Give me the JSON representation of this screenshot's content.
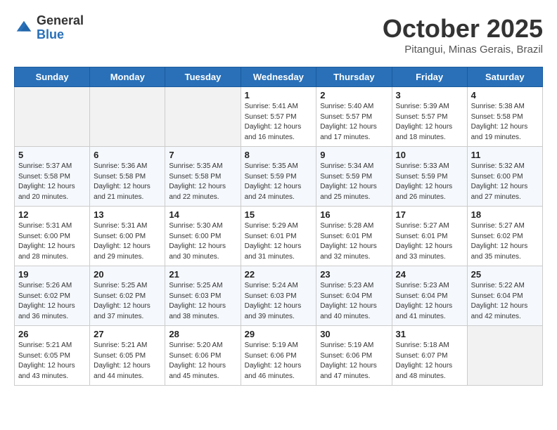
{
  "header": {
    "logo": {
      "general": "General",
      "blue": "Blue"
    },
    "month": "October 2025",
    "location": "Pitangui, Minas Gerais, Brazil"
  },
  "weekdays": [
    "Sunday",
    "Monday",
    "Tuesday",
    "Wednesday",
    "Thursday",
    "Friday",
    "Saturday"
  ],
  "weeks": [
    [
      {
        "day": "",
        "info": ""
      },
      {
        "day": "",
        "info": ""
      },
      {
        "day": "",
        "info": ""
      },
      {
        "day": "1",
        "info": "Sunrise: 5:41 AM\nSunset: 5:57 PM\nDaylight: 12 hours\nand 16 minutes."
      },
      {
        "day": "2",
        "info": "Sunrise: 5:40 AM\nSunset: 5:57 PM\nDaylight: 12 hours\nand 17 minutes."
      },
      {
        "day": "3",
        "info": "Sunrise: 5:39 AM\nSunset: 5:57 PM\nDaylight: 12 hours\nand 18 minutes."
      },
      {
        "day": "4",
        "info": "Sunrise: 5:38 AM\nSunset: 5:58 PM\nDaylight: 12 hours\nand 19 minutes."
      }
    ],
    [
      {
        "day": "5",
        "info": "Sunrise: 5:37 AM\nSunset: 5:58 PM\nDaylight: 12 hours\nand 20 minutes."
      },
      {
        "day": "6",
        "info": "Sunrise: 5:36 AM\nSunset: 5:58 PM\nDaylight: 12 hours\nand 21 minutes."
      },
      {
        "day": "7",
        "info": "Sunrise: 5:35 AM\nSunset: 5:58 PM\nDaylight: 12 hours\nand 22 minutes."
      },
      {
        "day": "8",
        "info": "Sunrise: 5:35 AM\nSunset: 5:59 PM\nDaylight: 12 hours\nand 24 minutes."
      },
      {
        "day": "9",
        "info": "Sunrise: 5:34 AM\nSunset: 5:59 PM\nDaylight: 12 hours\nand 25 minutes."
      },
      {
        "day": "10",
        "info": "Sunrise: 5:33 AM\nSunset: 5:59 PM\nDaylight: 12 hours\nand 26 minutes."
      },
      {
        "day": "11",
        "info": "Sunrise: 5:32 AM\nSunset: 6:00 PM\nDaylight: 12 hours\nand 27 minutes."
      }
    ],
    [
      {
        "day": "12",
        "info": "Sunrise: 5:31 AM\nSunset: 6:00 PM\nDaylight: 12 hours\nand 28 minutes."
      },
      {
        "day": "13",
        "info": "Sunrise: 5:31 AM\nSunset: 6:00 PM\nDaylight: 12 hours\nand 29 minutes."
      },
      {
        "day": "14",
        "info": "Sunrise: 5:30 AM\nSunset: 6:00 PM\nDaylight: 12 hours\nand 30 minutes."
      },
      {
        "day": "15",
        "info": "Sunrise: 5:29 AM\nSunset: 6:01 PM\nDaylight: 12 hours\nand 31 minutes."
      },
      {
        "day": "16",
        "info": "Sunrise: 5:28 AM\nSunset: 6:01 PM\nDaylight: 12 hours\nand 32 minutes."
      },
      {
        "day": "17",
        "info": "Sunrise: 5:27 AM\nSunset: 6:01 PM\nDaylight: 12 hours\nand 33 minutes."
      },
      {
        "day": "18",
        "info": "Sunrise: 5:27 AM\nSunset: 6:02 PM\nDaylight: 12 hours\nand 35 minutes."
      }
    ],
    [
      {
        "day": "19",
        "info": "Sunrise: 5:26 AM\nSunset: 6:02 PM\nDaylight: 12 hours\nand 36 minutes."
      },
      {
        "day": "20",
        "info": "Sunrise: 5:25 AM\nSunset: 6:02 PM\nDaylight: 12 hours\nand 37 minutes."
      },
      {
        "day": "21",
        "info": "Sunrise: 5:25 AM\nSunset: 6:03 PM\nDaylight: 12 hours\nand 38 minutes."
      },
      {
        "day": "22",
        "info": "Sunrise: 5:24 AM\nSunset: 6:03 PM\nDaylight: 12 hours\nand 39 minutes."
      },
      {
        "day": "23",
        "info": "Sunrise: 5:23 AM\nSunset: 6:04 PM\nDaylight: 12 hours\nand 40 minutes."
      },
      {
        "day": "24",
        "info": "Sunrise: 5:23 AM\nSunset: 6:04 PM\nDaylight: 12 hours\nand 41 minutes."
      },
      {
        "day": "25",
        "info": "Sunrise: 5:22 AM\nSunset: 6:04 PM\nDaylight: 12 hours\nand 42 minutes."
      }
    ],
    [
      {
        "day": "26",
        "info": "Sunrise: 5:21 AM\nSunset: 6:05 PM\nDaylight: 12 hours\nand 43 minutes."
      },
      {
        "day": "27",
        "info": "Sunrise: 5:21 AM\nSunset: 6:05 PM\nDaylight: 12 hours\nand 44 minutes."
      },
      {
        "day": "28",
        "info": "Sunrise: 5:20 AM\nSunset: 6:06 PM\nDaylight: 12 hours\nand 45 minutes."
      },
      {
        "day": "29",
        "info": "Sunrise: 5:19 AM\nSunset: 6:06 PM\nDaylight: 12 hours\nand 46 minutes."
      },
      {
        "day": "30",
        "info": "Sunrise: 5:19 AM\nSunset: 6:06 PM\nDaylight: 12 hours\nand 47 minutes."
      },
      {
        "day": "31",
        "info": "Sunrise: 5:18 AM\nSunset: 6:07 PM\nDaylight: 12 hours\nand 48 minutes."
      },
      {
        "day": "",
        "info": ""
      }
    ]
  ]
}
